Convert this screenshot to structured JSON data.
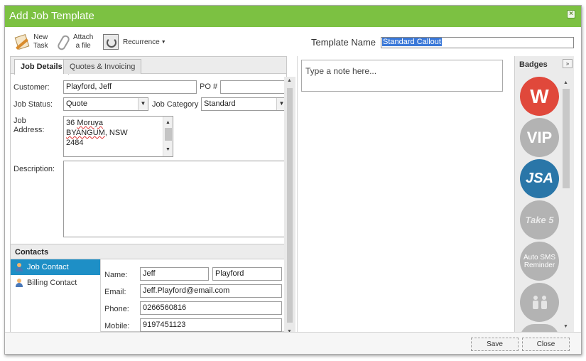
{
  "window": {
    "title": "Add Job Template"
  },
  "toolbar": {
    "new_label_1": "New",
    "new_label_2": "Task",
    "attach_label_1": "Attach",
    "attach_label_2": "a file",
    "recurrence_label": "Recurrence"
  },
  "template": {
    "label": "Template Name",
    "value": "Standard Callout"
  },
  "tabs": [
    {
      "label": "Job Details"
    },
    {
      "label": "Quotes & Invoicing"
    }
  ],
  "form": {
    "customer_label": "Customer:",
    "customer_value": "Playford, Jeff",
    "po_label": "PO #",
    "po_value": "",
    "status_label": "Job Status:",
    "status_value": "Quote",
    "category_label": "Job Category",
    "category_value": "Standard",
    "address_label_1": "Job",
    "address_label_2": "Address:",
    "address_line1_number": "36",
    "address_line1_street": "Moruya",
    "address_line2_suburb": "BYANGUM",
    "address_line2_state": ", NSW",
    "address_line3": "2484",
    "description_label": "Description:"
  },
  "contacts": {
    "header": "Contacts",
    "items": [
      {
        "label": "Job Contact"
      },
      {
        "label": "Billing Contact"
      }
    ],
    "name_label": "Name:",
    "first_name": "Jeff",
    "last_name": "Playford",
    "email_label": "Email:",
    "email": "Jeff.Playford@email.com",
    "phone_label": "Phone:",
    "phone": "0266560816",
    "mobile_label": "Mobile:",
    "mobile": "9197451123"
  },
  "note": {
    "placeholder": "Type a  note here..."
  },
  "badges": {
    "header": "Badges",
    "items": [
      {
        "label": "W"
      },
      {
        "label": "VIP"
      },
      {
        "label": "JSA"
      },
      {
        "label": "Take 5"
      },
      {
        "label_1": "Auto SMS",
        "label_2": "Reminder"
      }
    ]
  },
  "footer": {
    "save_label": "Save",
    "close_label": "Close"
  },
  "colors": {
    "titlebar": "#7cc142",
    "active_contact": "#1e8fc6",
    "badge_w": "#e0483b",
    "badge_jsa": "#2a76a8",
    "badge_inactive": "#b3b3b3"
  }
}
